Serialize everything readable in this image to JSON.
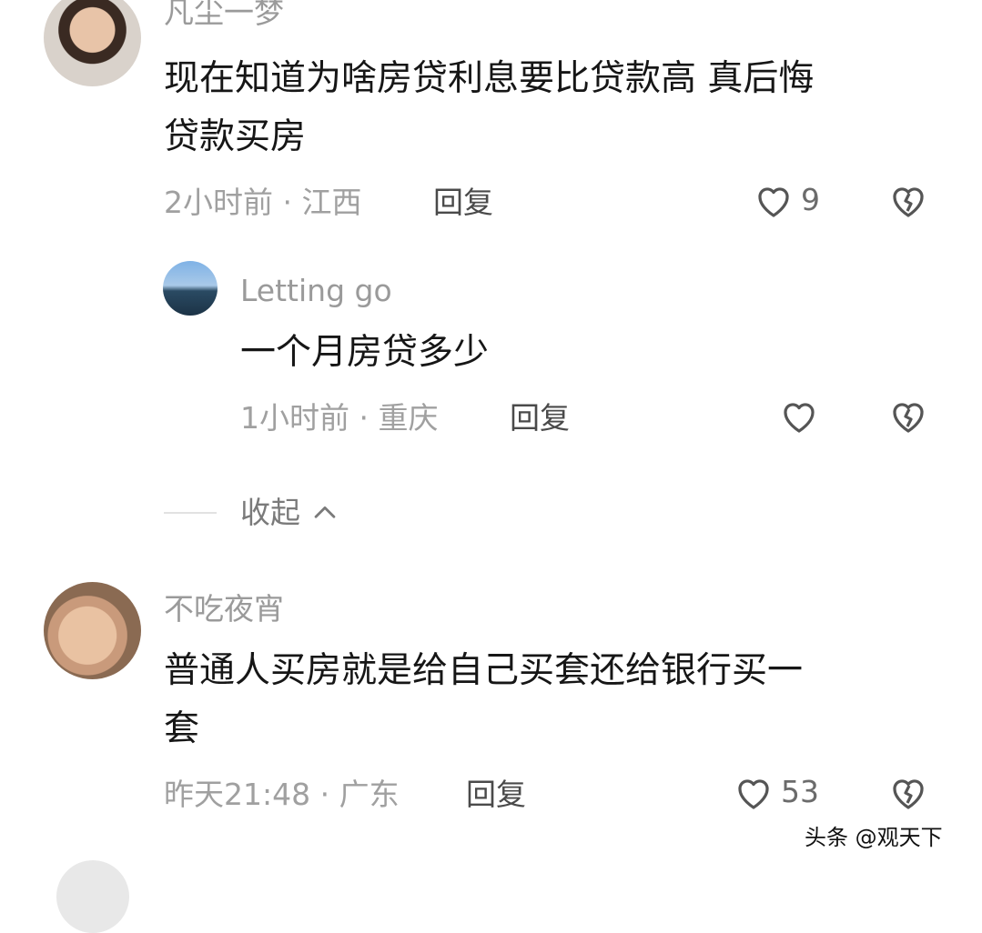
{
  "comments": [
    {
      "username": "凡尘一梦",
      "text_lines": [
        "现在知道为啥房贷利息要比贷款高 真后悔",
        "贷款买房"
      ],
      "time_location": "2小时前 · 江西",
      "reply_label": "回复",
      "like_count": "9",
      "replies": [
        {
          "username": "Letting go",
          "text_lines": [
            "一个月房贷多少"
          ],
          "time_location": "1小时前 · 重庆",
          "reply_label": "回复",
          "like_count": ""
        }
      ],
      "collapse_label": "收起"
    },
    {
      "username": "不吃夜宵",
      "text_lines": [
        "普通人买房就是给自己买套还给银行买一",
        "套"
      ],
      "time_location": "昨天21:48 · 广东",
      "reply_label": "回复",
      "like_count": "53"
    }
  ],
  "watermark": "头条 @观天下",
  "icons": {
    "like": "heart-outline-icon",
    "dislike": "broken-heart-icon",
    "collapse": "chevron-up-icon"
  },
  "colors": {
    "text": "#161616",
    "muted": "#a0a0a0",
    "icon": "#555555"
  }
}
